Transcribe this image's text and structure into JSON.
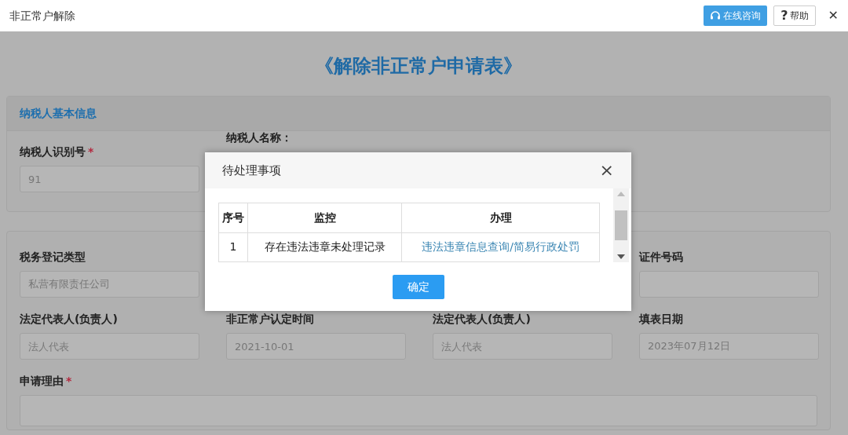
{
  "window": {
    "title": "非正常户解除",
    "consult_button": "在线咨询",
    "help_button": {
      "glyph": "?",
      "label": "帮助"
    },
    "close": "✕"
  },
  "form_title": "《解除非正常户申请表》",
  "basic_info": {
    "heading": "纳税人基本信息",
    "fields": [
      {
        "label": "纳税人识别号",
        "required_mark": "*",
        "value": "91"
      },
      {
        "label": "纳税人名称："
      }
    ]
  },
  "details": {
    "fields": [
      {
        "label": "税务登记类型",
        "value": "私营有限责任公司"
      },
      {
        "label": "证件号码"
      },
      {
        "label": "法定代表人(负责人)",
        "placeholder": "法人代表"
      },
      {
        "label": "非正常户认定时间",
        "value": "2021-10-01"
      },
      {
        "label": "法定代表人(负责人)",
        "placeholder": "法人代表"
      },
      {
        "label": "填表日期",
        "value": "2023年07月12日"
      }
    ],
    "reason": {
      "label": "申请理由",
      "required_mark": "*"
    }
  },
  "dialog": {
    "title": "待处理事项",
    "close": "×",
    "table": {
      "columns": [
        "序号",
        "监控",
        "办理"
      ],
      "rows": [
        {
          "index": "1",
          "item": "存在违法违章未处理记录",
          "action": "违法违章信息查询/简易行政处罚"
        }
      ]
    },
    "ok_button": "确定"
  }
}
